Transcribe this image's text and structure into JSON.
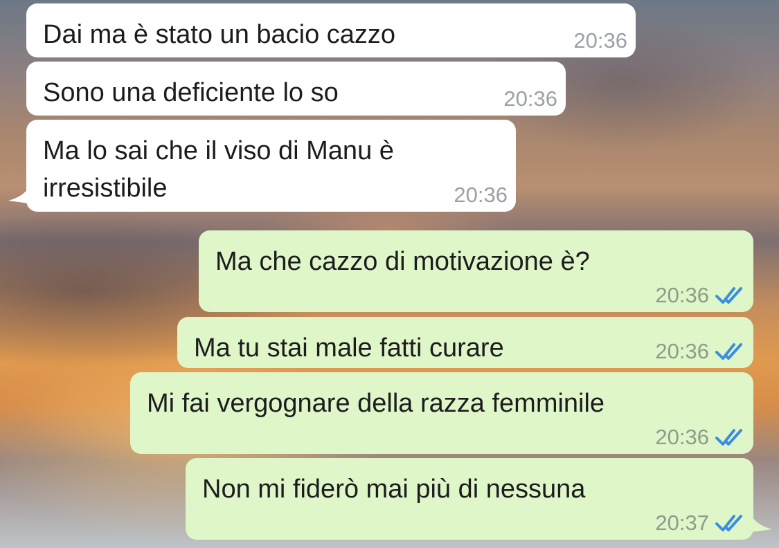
{
  "messages": [
    {
      "direction": "incoming",
      "text": "Dai ma è stato un bacio cazzo",
      "time": "20:36"
    },
    {
      "direction": "incoming",
      "text": "Sono una deficiente lo so",
      "time": "20:36"
    },
    {
      "direction": "incoming",
      "text": "Ma lo sai che il viso di Manu è\nirresistibile",
      "time": "20:36"
    },
    {
      "direction": "outgoing",
      "text": "Ma che cazzo di motivazione è?",
      "time": "20:36",
      "status_icon": "double-check-icon"
    },
    {
      "direction": "outgoing",
      "text": "Ma tu stai male fatti curare",
      "time": "20:36",
      "status_icon": "double-check-icon"
    },
    {
      "direction": "outgoing",
      "text": "Mi fai vergognare della razza femminile",
      "time": "20:36",
      "status_icon": "double-check-icon"
    },
    {
      "direction": "outgoing",
      "text": "Non mi fiderò mai più di nessuna",
      "time": "20:37",
      "status_icon": "double-check-icon"
    }
  ],
  "colors": {
    "incoming_bubble": "#ffffff",
    "outgoing_bubble": "#dff7c8",
    "read_ticks": "#3b8de0",
    "timestamp": "#9aa0a6"
  }
}
